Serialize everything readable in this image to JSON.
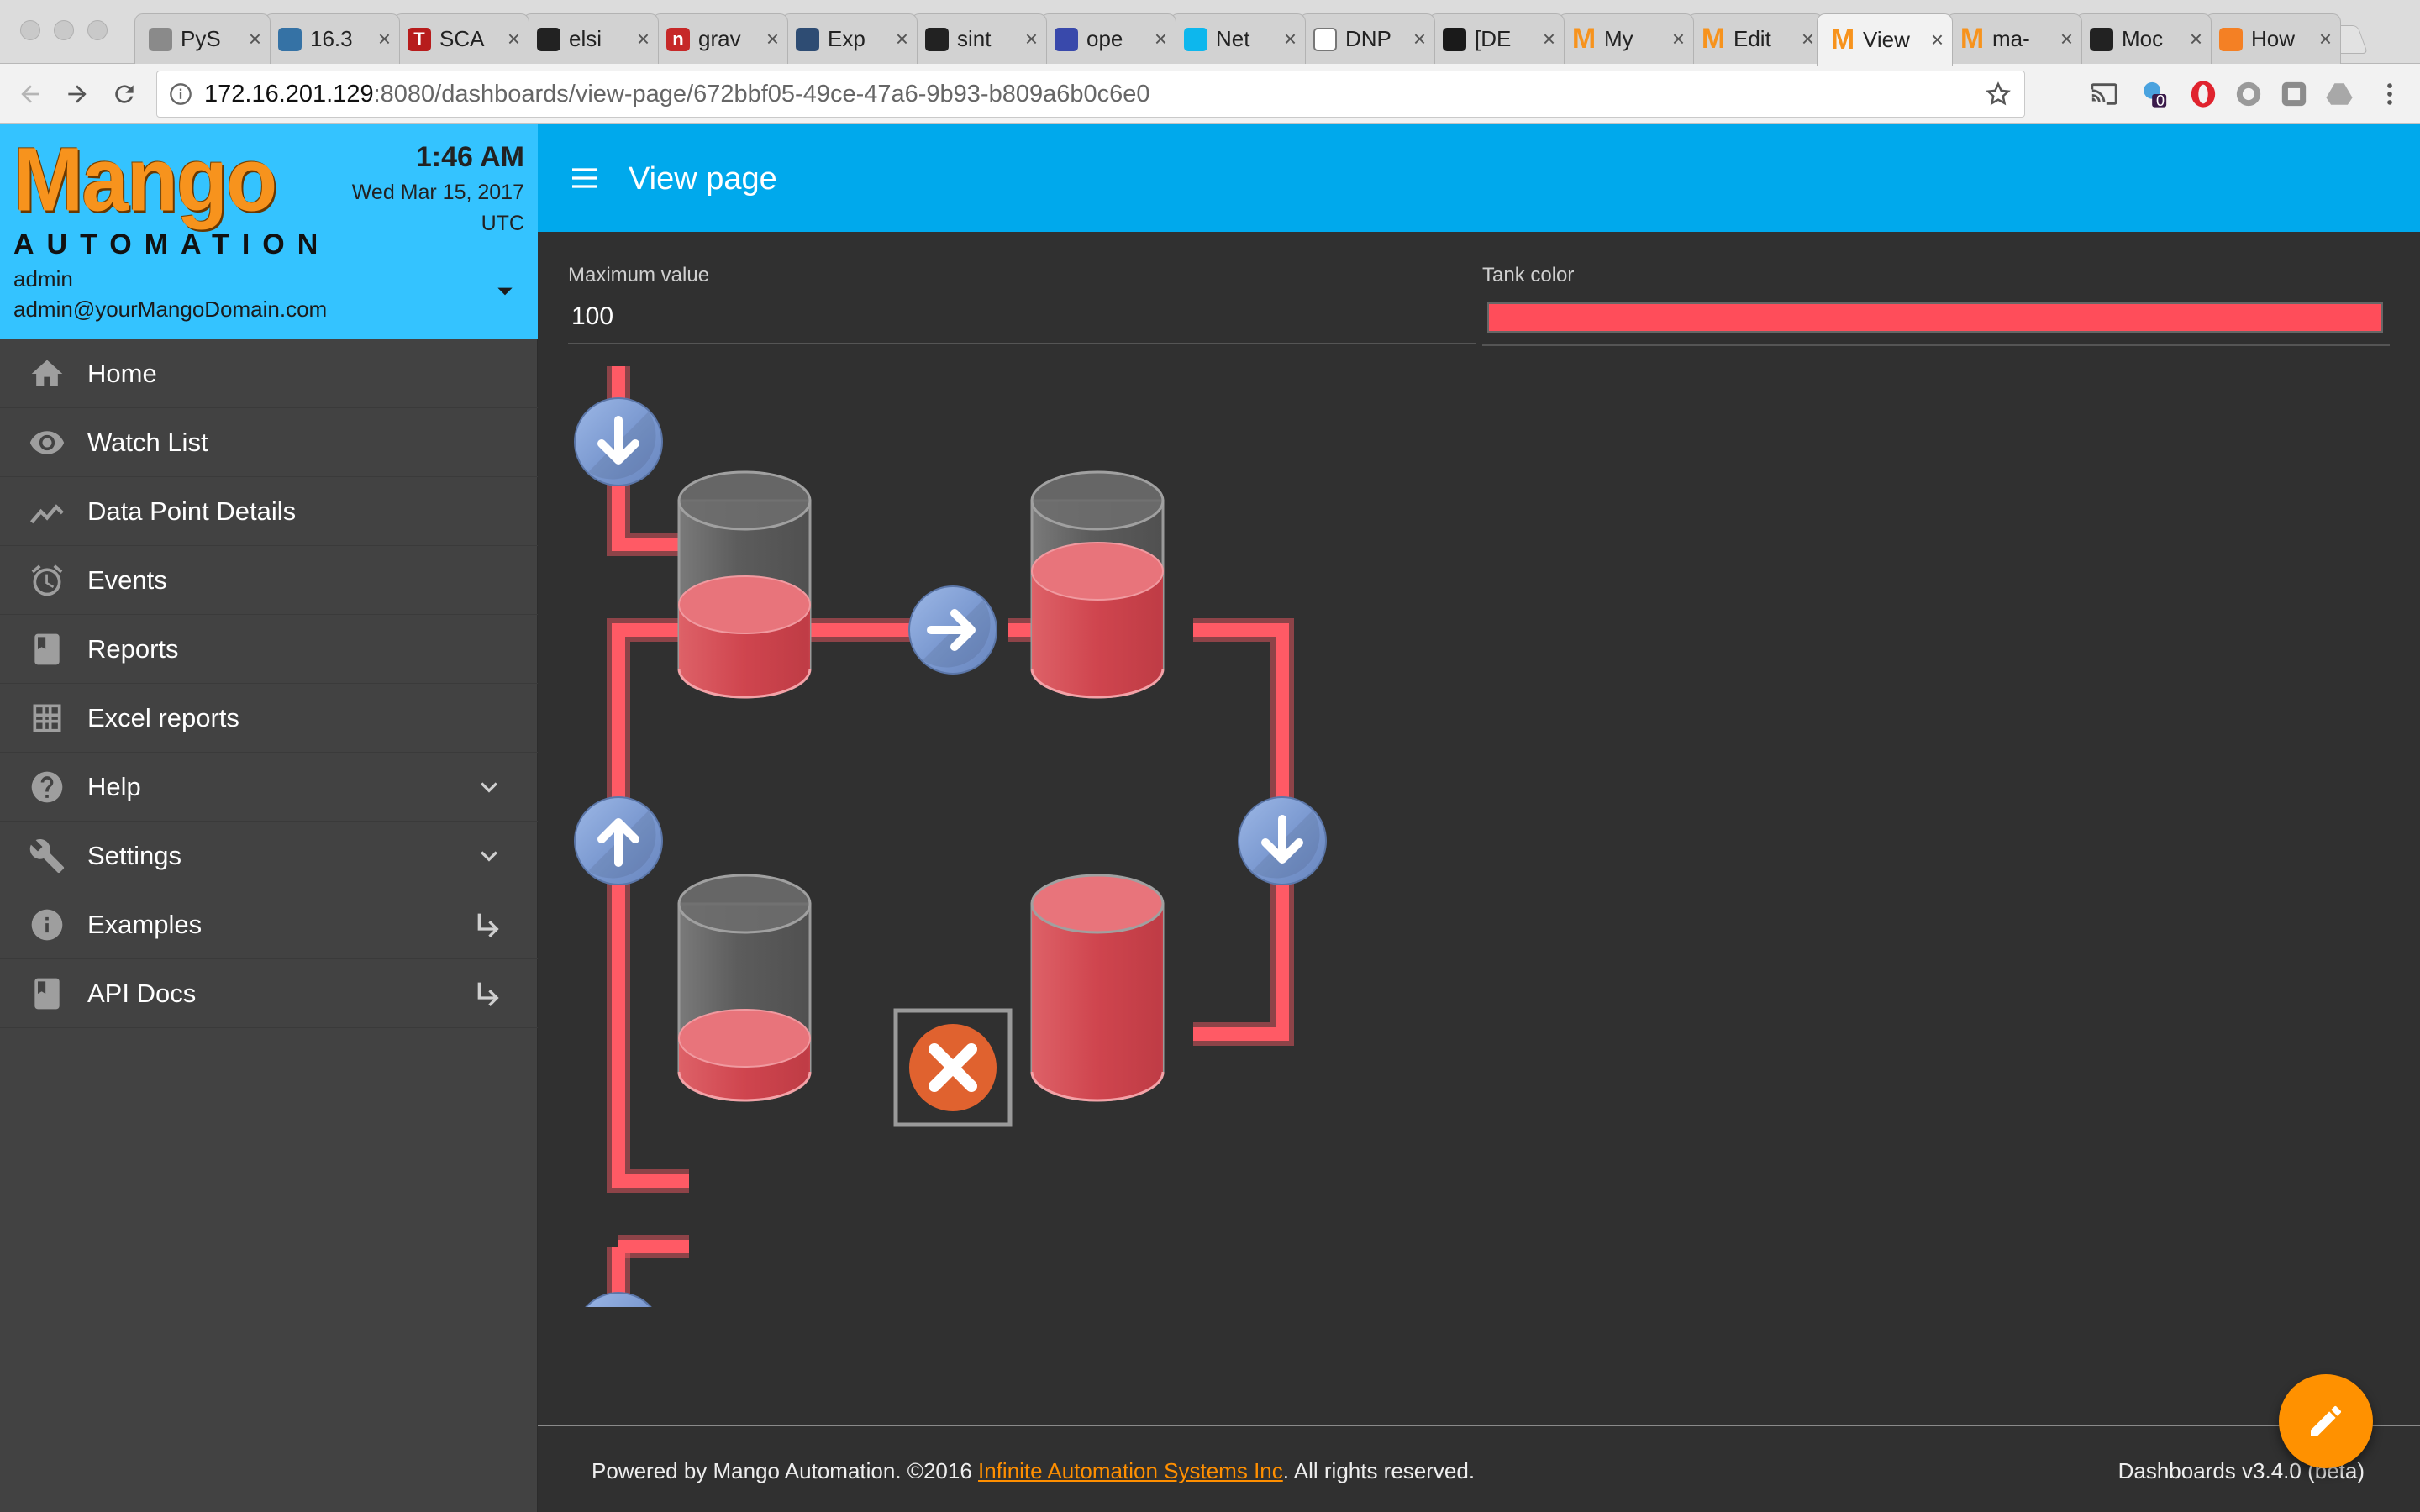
{
  "browser": {
    "tabs": [
      {
        "title": "PyS",
        "icon": "pysnmp-icon",
        "color": "#8a8a8a",
        "glyph": ""
      },
      {
        "title": "16.3",
        "icon": "python-icon",
        "color": "#3572a5",
        "glyph": ""
      },
      {
        "title": "SCA",
        "icon": "t-icon",
        "color": "#b71c1c",
        "glyph": "T"
      },
      {
        "title": "elsi",
        "icon": "github-icon",
        "color": "#222222",
        "glyph": ""
      },
      {
        "title": "grav",
        "icon": "n-icon",
        "color": "#c62828",
        "glyph": "n"
      },
      {
        "title": "Exp",
        "icon": "docker-icon",
        "color": "#2e4c73",
        "glyph": ""
      },
      {
        "title": "sint",
        "icon": "github-icon",
        "color": "#222222",
        "glyph": ""
      },
      {
        "title": "ope",
        "icon": "globe-icon",
        "color": "#3949ab",
        "glyph": ""
      },
      {
        "title": "Net",
        "icon": "docker-icon",
        "color": "#0db7ed",
        "glyph": ""
      },
      {
        "title": "DNP",
        "icon": "document-icon",
        "color": "#ffffff",
        "glyph": ""
      },
      {
        "title": "[DE",
        "icon": "dark-icon",
        "color": "#1a1a1a",
        "glyph": ""
      },
      {
        "title": "My",
        "icon": "mango-icon",
        "color": "#f7931d",
        "glyph": "M"
      },
      {
        "title": "Edit",
        "icon": "mango-icon",
        "color": "#f7931d",
        "glyph": "M"
      },
      {
        "title": "View",
        "icon": "mango-icon",
        "color": "#f7931d",
        "glyph": "M"
      },
      {
        "title": "ma-",
        "icon": "mango-icon",
        "color": "#f7931d",
        "glyph": "M"
      },
      {
        "title": "Moc",
        "icon": "github-icon",
        "color": "#222222",
        "glyph": ""
      },
      {
        "title": "How",
        "icon": "stackoverflow-icon",
        "color": "#f48024",
        "glyph": ""
      }
    ],
    "active_tab": 13,
    "url_host": "172.16.201.129",
    "url_path": ":8080/dashboards/view-page/672bbf05-49ce-47a6-9b93-b809a6b0c6e0",
    "extension_badge": "0"
  },
  "sidebar": {
    "logo_text": "Mango",
    "logo_sub": "AUTOMATION",
    "time": "1:46 AM",
    "date": "Wed Mar 15, 2017",
    "timezone": "UTC",
    "username": "admin",
    "email": "admin@yourMangoDomain.com",
    "items": [
      {
        "label": "Home",
        "icon": "home-icon",
        "right": ""
      },
      {
        "label": "Watch List",
        "icon": "eye-icon",
        "right": ""
      },
      {
        "label": "Data Point Details",
        "icon": "chart-line-icon",
        "right": ""
      },
      {
        "label": "Events",
        "icon": "alarm-icon",
        "right": ""
      },
      {
        "label": "Reports",
        "icon": "book-icon",
        "right": ""
      },
      {
        "label": "Excel reports",
        "icon": "grid-icon",
        "right": ""
      },
      {
        "label": "Help",
        "icon": "help-icon",
        "right": "chevron-down-icon"
      },
      {
        "label": "Settings",
        "icon": "wrench-icon",
        "right": "chevron-down-icon"
      },
      {
        "label": "Examples",
        "icon": "info-icon",
        "right": "subdirectory-arrow-icon"
      },
      {
        "label": "API Docs",
        "icon": "book-icon",
        "right": "subdirectory-arrow-icon"
      }
    ]
  },
  "header": {
    "title": "View page"
  },
  "fields": {
    "max_label": "Maximum value",
    "max_value": "100",
    "color_label": "Tank color",
    "tank_color": "#ff4d5a"
  },
  "diagram": {
    "pipe_color": "#ff5a65",
    "tank_fill_color": "#f0434f",
    "tanks": [
      {
        "name": "tank-top-left",
        "level": 0.38
      },
      {
        "name": "tank-top-right",
        "level": 0.58
      },
      {
        "name": "tank-bottom-left",
        "level": 0.2
      },
      {
        "name": "tank-bottom-right",
        "level": 1.0
      }
    ],
    "pumps": [
      {
        "name": "pump-inlet",
        "direction": "down"
      },
      {
        "name": "pump-transfer",
        "direction": "right"
      },
      {
        "name": "pump-return",
        "direction": "up"
      },
      {
        "name": "pump-right",
        "direction": "down"
      },
      {
        "name": "pump-outlet",
        "direction": "down"
      }
    ],
    "valve": {
      "name": "valve-closed",
      "state": "closed"
    }
  },
  "footer": {
    "text_before": "Powered by Mango Automation. ©2016 ",
    "company": "Infinite Automation Systems Inc",
    "text_after": ". All rights reserved.",
    "version": "Dashboards v3.4.0 (beta)"
  },
  "colors": {
    "header": "#00a9ec",
    "sidebar_head": "#34c3ff",
    "sidebar": "#424242",
    "content": "#303030",
    "accent": "#ff9100"
  }
}
